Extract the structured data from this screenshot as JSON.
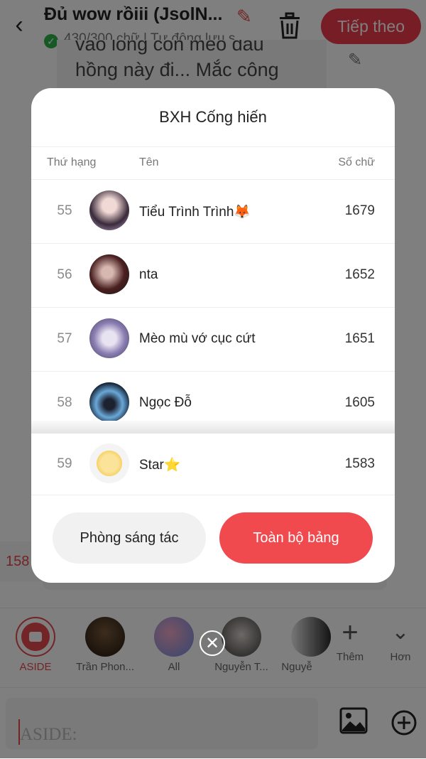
{
  "header": {
    "story_title": "Đủ wow rồiii (JsolN...",
    "word_status": "430/300 chữ | Tự động lưu s",
    "next_label": "Tiếp theo"
  },
  "background": {
    "text_line_1": "vào lòng con mèo đầu",
    "text_line_2": "hồng này đi... Mắc công",
    "partial_number": "158"
  },
  "leaderboard": {
    "title": "BXH Cống hiến",
    "col_rank": "Thứ hạng",
    "col_name": "Tên",
    "col_count": "Số chữ",
    "rows": [
      {
        "rank": "55",
        "name": "Tiểu Trình Trình🦊",
        "count": "1679"
      },
      {
        "rank": "56",
        "name": "nta",
        "count": "1652"
      },
      {
        "rank": "57",
        "name": "Mèo mù vớ cục cứt",
        "count": "1651"
      },
      {
        "rank": "58",
        "name": "Ngọc Đỗ",
        "count": "1605"
      },
      {
        "rank": "59",
        "name": "Star⭐",
        "count": "1583"
      }
    ],
    "btn_room": "Phòng sáng tác",
    "btn_full": "Toàn bộ bảng"
  },
  "characters": {
    "items": [
      {
        "label": "ASIDE"
      },
      {
        "label": "Trần Phon..."
      },
      {
        "label": "All"
      },
      {
        "label": "Nguyễn T..."
      },
      {
        "label": "Nguyễ"
      }
    ],
    "add_label": "Thêm",
    "more_label": "Hơn"
  },
  "input": {
    "placeholder": "ASIDE:"
  },
  "colors": {
    "accent": "#EE3B4A",
    "check_green": "#2EB34A"
  }
}
